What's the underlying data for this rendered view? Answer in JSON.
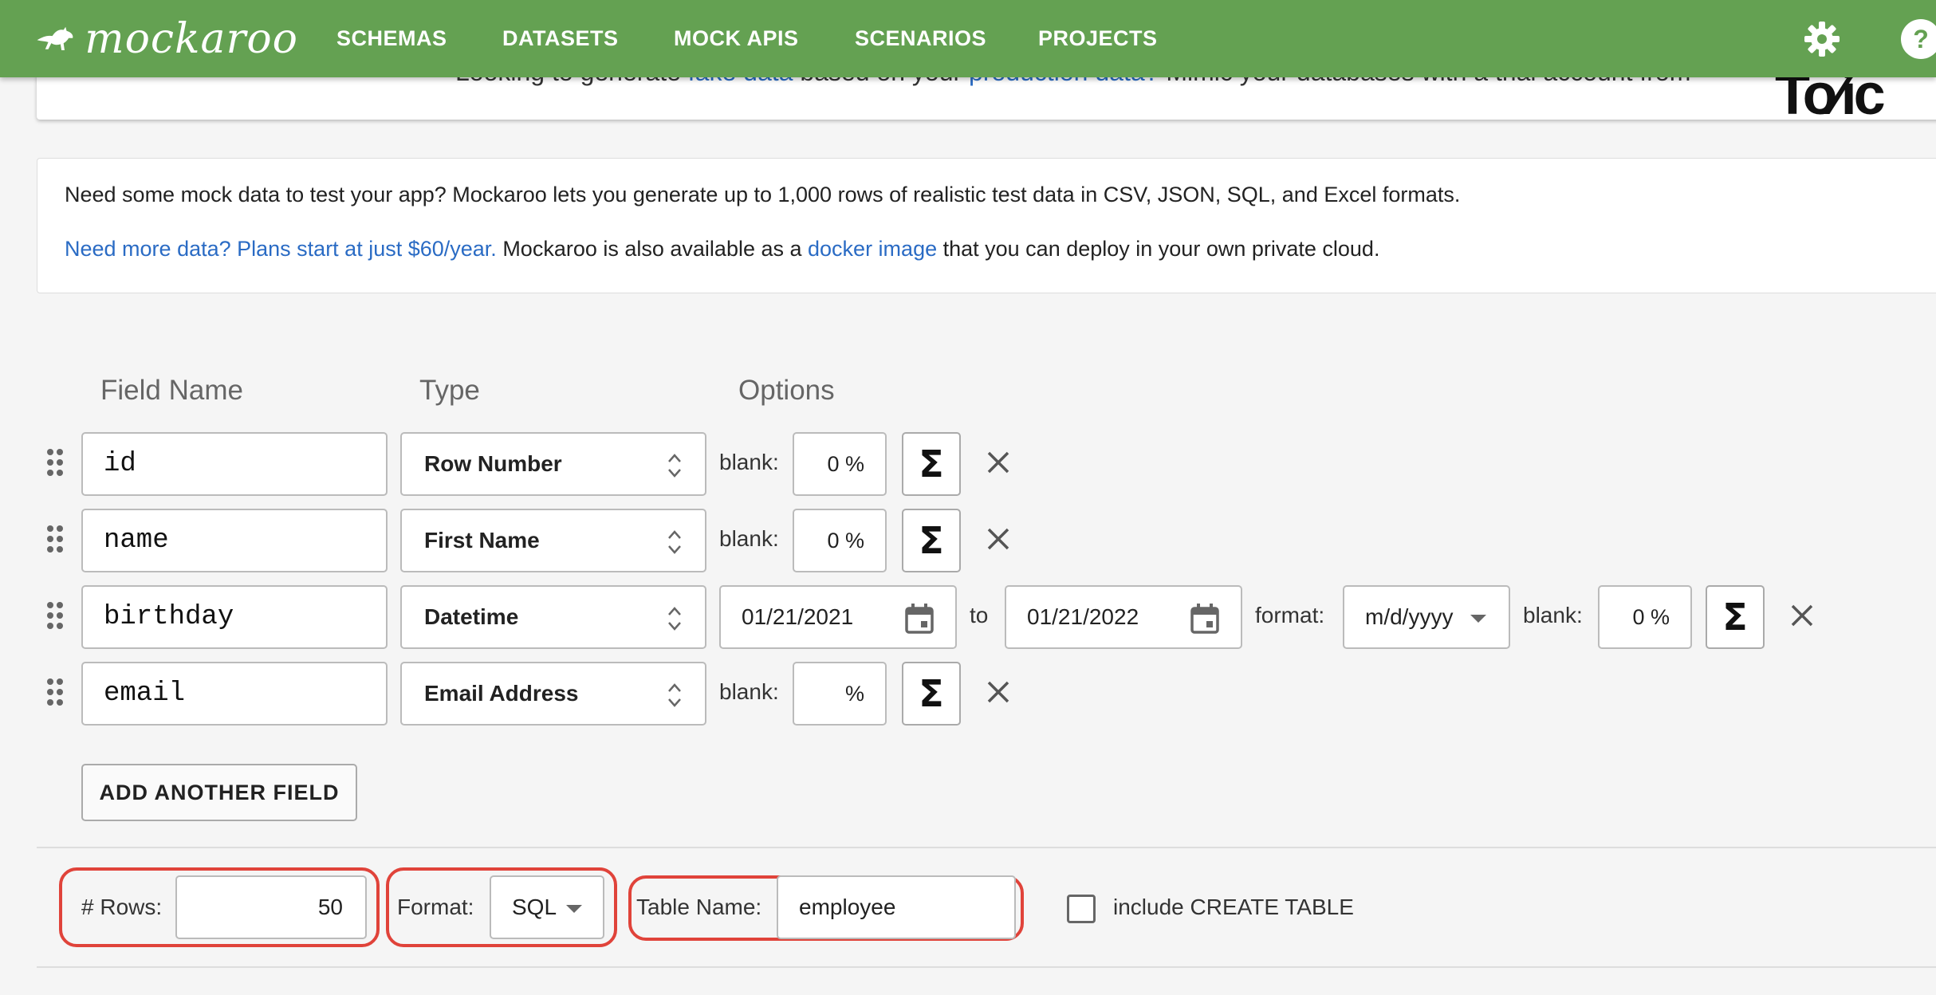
{
  "brand": {
    "logo_text": "mockaroo"
  },
  "nav": {
    "items": [
      "SCHEMAS",
      "DATASETS",
      "MOCK APIS",
      "SCENARIOS",
      "PROJECTS"
    ]
  },
  "banner": {
    "text_before": "Looking to generate ",
    "link1": "fake data",
    "text_middle": " based on your ",
    "link2": "production data?",
    "text_after": " Mimic your databases with a trial account from",
    "logo": "To∕ic"
  },
  "info": {
    "line1": "Need some mock data to test your app? Mockaroo lets you generate up to 1,000 rows of realistic test data in CSV, JSON, SQL, and Excel formats.",
    "plans_link": "Need more data? Plans start at just $60/year.",
    "line2_middle": " Mockaroo is also available as a ",
    "docker_link": "docker image",
    "line2_end": " that you can deploy in your own private cloud."
  },
  "columns": {
    "field_name": "Field Name",
    "type": "Type",
    "options": "Options"
  },
  "fields": [
    {
      "name": "id",
      "type": "Row Number",
      "blank_label": "blank:",
      "blank_value": "0 %"
    },
    {
      "name": "name",
      "type": "First Name",
      "blank_label": "blank:",
      "blank_value": "0 %"
    },
    {
      "name": "birthday",
      "type": "Datetime",
      "date_from": "01/21/2021",
      "to_label": "to",
      "date_to": "01/21/2022",
      "format_label": "format:",
      "format_value": "m/d/yyyy",
      "blank_label": "blank:",
      "blank_value": "0 %"
    },
    {
      "name": "email",
      "type": "Email Address",
      "blank_label": "blank:",
      "blank_value": "%"
    }
  ],
  "add_field_label": "ADD ANOTHER FIELD",
  "controls": {
    "rows_label": "# Rows:",
    "rows_value": "50",
    "format_label": "Format:",
    "format_value": "SQL",
    "table_label": "Table Name:",
    "table_value": "employee",
    "create_table_label": "include CREATE TABLE",
    "create_table_checked": false
  },
  "colors": {
    "header": "#64a152",
    "link": "#2a6bc4",
    "highlight": "#e0433a"
  },
  "icons": [
    "kangaroo-logo-icon",
    "settings-gear-icon",
    "help-icon",
    "drag-handle-icon",
    "up-down-icon",
    "sigma-icon",
    "close-icon",
    "calendar-icon",
    "caret-down-icon"
  ]
}
